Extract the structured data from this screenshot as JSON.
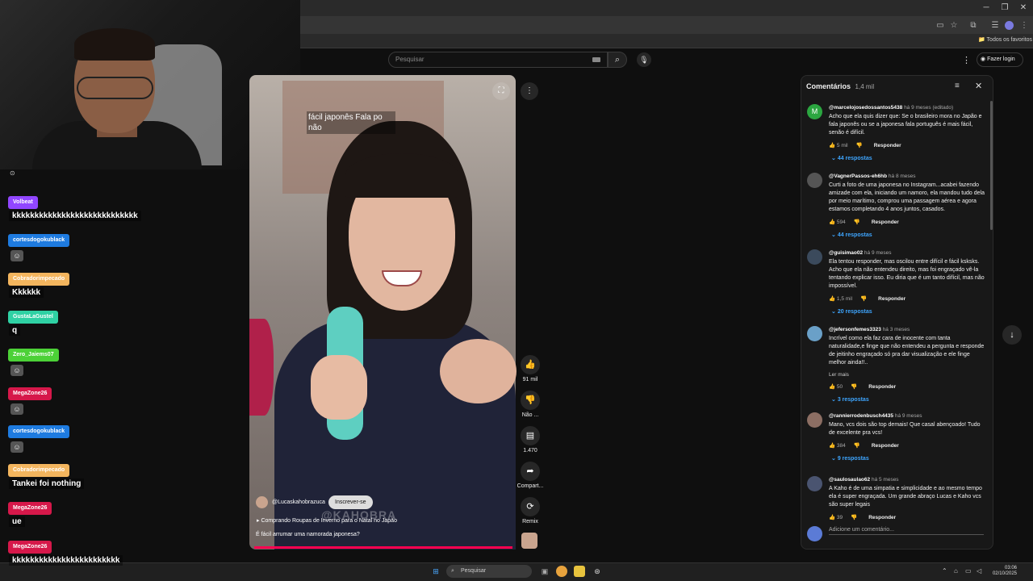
{
  "browser": {
    "bookmark_bar_label": "Todos os favoritos"
  },
  "youtube": {
    "search_placeholder": "Pesquisar",
    "login_label": "Fazer login"
  },
  "video": {
    "caption": "fácil japonês Fala po não",
    "channel": "@Lucaskahobrazuca",
    "subscribe_label": "Inscrever-se",
    "song": "Comprando Roupas de Inverno para o Natal no Japão",
    "title": "É fácil arrumar uma namorada japonesa?",
    "watermark": "@KAHOBRA",
    "actions": [
      {
        "icon": "like-icon",
        "label": "91 mil"
      },
      {
        "icon": "dislike-icon",
        "label": "Não ..."
      },
      {
        "icon": "comment-icon",
        "label": "1.470"
      },
      {
        "icon": "share-icon",
        "label": "Compart..."
      },
      {
        "icon": "remix-icon",
        "label": "Remix"
      }
    ],
    "progress": 1.0
  },
  "chat": [
    {
      "user": "Volbeat",
      "color": "#9146ff",
      "message": "kkkkkkkkkkkkkkkkkkkkkkkkkkkk"
    },
    {
      "user": "cortesdogokublack",
      "color": "#1e7be0",
      "message": "",
      "emote": "emote"
    },
    {
      "user": "Cobradorimpecado",
      "color": "#f3b55e",
      "message": "Kkkkkk"
    },
    {
      "user": "GustaLaGustel",
      "color": "#2fd1a4",
      "message": "q"
    },
    {
      "user": "Zero_Jaiems07",
      "color": "#4cd137",
      "message": "",
      "emote": "emote"
    },
    {
      "user": "MegaZone26",
      "color": "#d6184a",
      "message": "",
      "emote": "emote"
    },
    {
      "user": "cortesdogokublack",
      "color": "#1e7be0",
      "message": "",
      "emote": "emote"
    },
    {
      "user": "Cobradorimpecado",
      "color": "#f3b55e",
      "message": "Tankei foi nothing"
    },
    {
      "user": "MegaZone26",
      "color": "#d6184a",
      "message": "ue"
    },
    {
      "user": "MegaZone26",
      "color": "#d6184a",
      "message": "kkkkkkkkkkkkkkkkkkkkkkkk"
    }
  ],
  "comments": {
    "title": "Comentários",
    "count": "1,4 mil",
    "add_placeholder": "Adicione um comentário...",
    "reply_label": "Responder",
    "read_more": "Ler mais",
    "items": [
      {
        "user": "@marcelojosedossantos5438",
        "time": "há 9 meses (editado)",
        "avatar_color": "#2ba640",
        "avatar_letter": "M",
        "text": "Acho que ela quis dizer que: Se o brasileiro mora no Japão e fala japonês  ou se a japonesa fala português é mais fácil, senão é difícil.",
        "likes": "5 mil",
        "replies": "44 respostas"
      },
      {
        "user": "@VagnerPassos-eh6hb",
        "time": "há 8 meses",
        "avatar_color": "#555555",
        "avatar_letter": "",
        "text": "Curti a foto de uma japonesa no Instagram...acabei fazendo amizade com ela, iniciando um namoro, ela mandou tudo dela por meio marítimo,  comprou uma passagem aérea e agora estamos completando 4 anos juntos, casados.",
        "likes": "594",
        "replies": "44 respostas"
      },
      {
        "user": "@guisimao02",
        "time": "há 9 meses",
        "avatar_color": "#3b4a5c",
        "avatar_letter": "",
        "text": "Ela tentou responder, mas oscilou entre difícil e fácil ksksks. Acho que ela não entendeu direito, mas foi engraçado vê-la tentando explicar isso. Eu diria que é um tanto difícil, mas não impossível.",
        "likes": "1,5 mil",
        "replies": "20 respostas"
      },
      {
        "user": "@jefersonfemes3323",
        "time": "há 3 meses",
        "avatar_color": "#6aa0c8",
        "avatar_letter": "",
        "text": "Incrível como ela faz cara de inocente com tanta naturalidade,e finge que não entendeu a pergunta e responde de jeitinho engraçado só pra dar visualização e ele finge melhor ainda!!..",
        "likes": "50",
        "replies": "3 respostas"
      },
      {
        "user": "@rannierrodenbusch4435",
        "time": "há 9 meses",
        "avatar_color": "#8c6e63",
        "avatar_letter": "",
        "text": "Mano, vcs dois são top demais! Que casal abençoado! Tudo de excelente pra vcs!",
        "likes": "384",
        "replies": "9 respostas"
      },
      {
        "user": "@saulosaulao62",
        "time": "há 5 meses",
        "avatar_color": "#4a5470",
        "avatar_letter": "",
        "text": "A Kaho é de uma simpatia e simplicidade e ao mesmo tempo ela é super engraçada. Um grande abraço Lucas e Kaho vcs são super legais",
        "likes": "39",
        "replies": ""
      }
    ]
  },
  "taskbar": {
    "search_placeholder": "Pesquisar",
    "time": "03:06",
    "date": "02/10/2025"
  }
}
